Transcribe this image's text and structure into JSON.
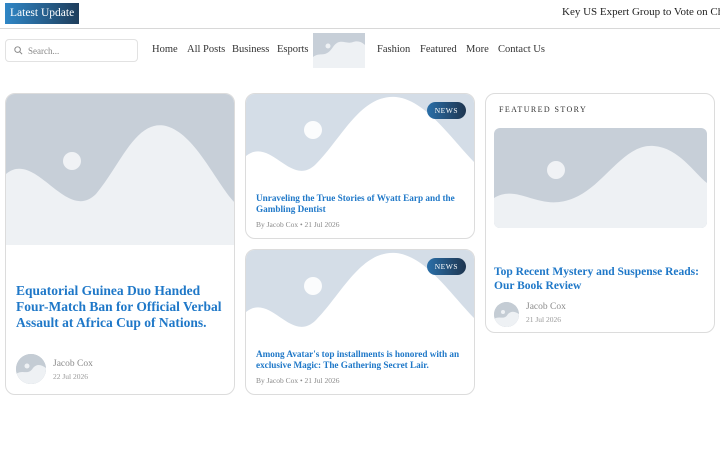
{
  "topbar": {
    "latest_label": "Latest Update",
    "ticker_text": "Key US Expert Group to Vote on Ch"
  },
  "search": {
    "placeholder": "Search..."
  },
  "nav": {
    "home": "Home",
    "all_posts": "All Posts",
    "business": "Business",
    "esports": "Esports",
    "fashion": "Fashion",
    "featured": "Featured",
    "more": "More",
    "contact": "Contact Us"
  },
  "main_post": {
    "title": "Equatorial Guinea Duo Handed Four-Match Ban for Official Verbal Assault at Africa Cup of Nations.",
    "author": "Jacob Cox",
    "date": "22 Jul 2026"
  },
  "posts": [
    {
      "badge": "NEWS",
      "title": "Unraveling the True Stories of Wyatt Earp and the Gambling Dentist",
      "meta": "By Jacob Cox   • 21 Jul 2026"
    },
    {
      "badge": "NEWS",
      "title": "Among Avatar's top installments is honored with an exclusive Magic: The Gathering Secret Lair.",
      "meta": "By Jacob Cox   • 21 Jul 2026"
    }
  ],
  "featured": {
    "label": "FEATURED STORY",
    "title": "Top Recent Mystery and Suspense Reads: Our Book Review",
    "author": "Jacob Cox",
    "date": "21 Jul 2026"
  },
  "colors": {
    "accent": "#1f78c8",
    "badge_start": "#2a6fa8",
    "badge_end": "#1e3550",
    "placeholder_bg": "#c7cfd8"
  },
  "icons": {
    "search": "search-icon",
    "image": "image-placeholder-icon"
  }
}
